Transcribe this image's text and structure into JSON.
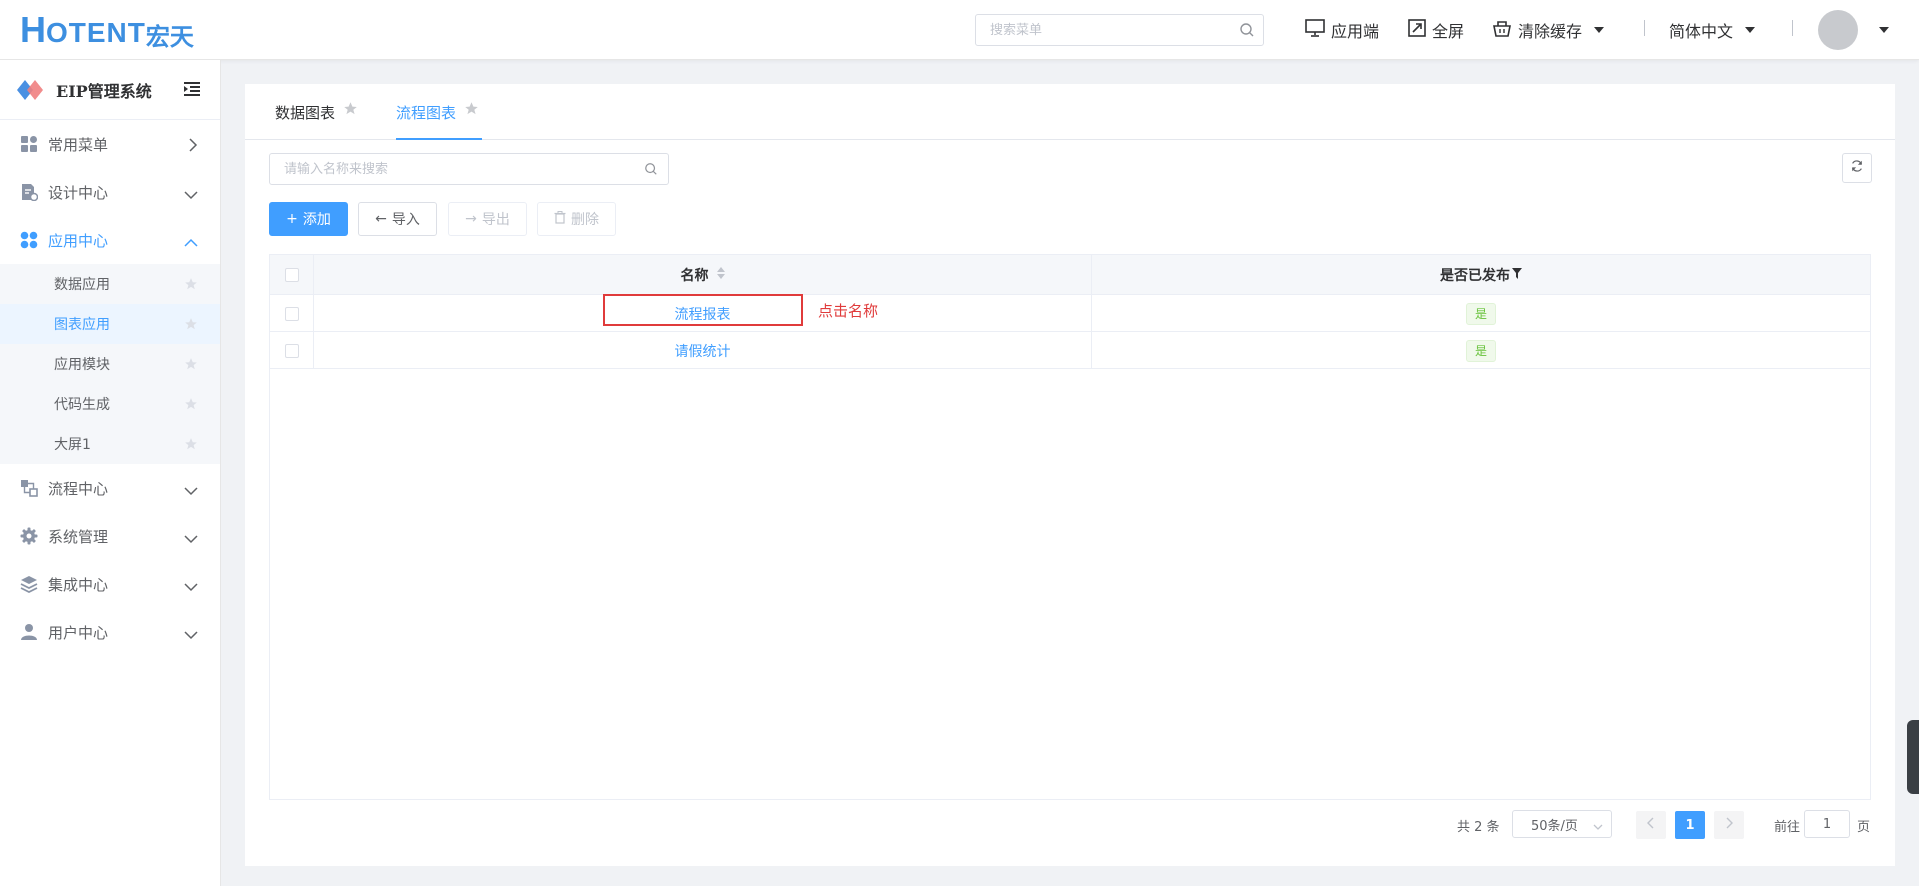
{
  "header": {
    "logo_letter": "H",
    "logo_text": "OTENT",
    "logo_cn": "宏天",
    "search_placeholder": "搜索菜单",
    "app_client": "应用端",
    "fullscreen": "全屏",
    "clear_cache": "清除缓存",
    "language": "简体中文"
  },
  "sidebar": {
    "system_title": "EIP管理系统",
    "items": [
      {
        "label": "常用菜单",
        "icon": "grid-icon"
      },
      {
        "label": "设计中心",
        "icon": "design-icon"
      },
      {
        "label": "应用中心",
        "icon": "apps-icon"
      },
      {
        "label": "流程中心",
        "icon": "flow-icon"
      },
      {
        "label": "系统管理",
        "icon": "gear-icon"
      },
      {
        "label": "集成中心",
        "icon": "layers-icon"
      },
      {
        "label": "用户中心",
        "icon": "user-icon"
      }
    ],
    "sub_items": [
      {
        "label": "数据应用"
      },
      {
        "label": "图表应用"
      },
      {
        "label": "应用模块"
      },
      {
        "label": "代码生成"
      },
      {
        "label": "大屏1"
      }
    ]
  },
  "tabs": [
    {
      "label": "数据图表"
    },
    {
      "label": "流程图表"
    }
  ],
  "toolbar": {
    "search_placeholder": "请输入名称来搜索",
    "add": "添加",
    "import": "导入",
    "export": "导出",
    "delete": "删除"
  },
  "table": {
    "columns": [
      "名称",
      "是否已发布"
    ],
    "rows": [
      {
        "name": "流程报表",
        "published": "是"
      },
      {
        "name": "请假统计",
        "published": "是"
      }
    ]
  },
  "annotation": "点击名称",
  "pagination": {
    "total": "共 2 条",
    "page_size": "50条/页",
    "current_page": "1",
    "goto_label": "前往",
    "goto_value": "1",
    "goto_suffix": "页"
  },
  "colors": {
    "primary": "#409eff",
    "annotation": "#e03b3b",
    "success": "#67c23a"
  }
}
